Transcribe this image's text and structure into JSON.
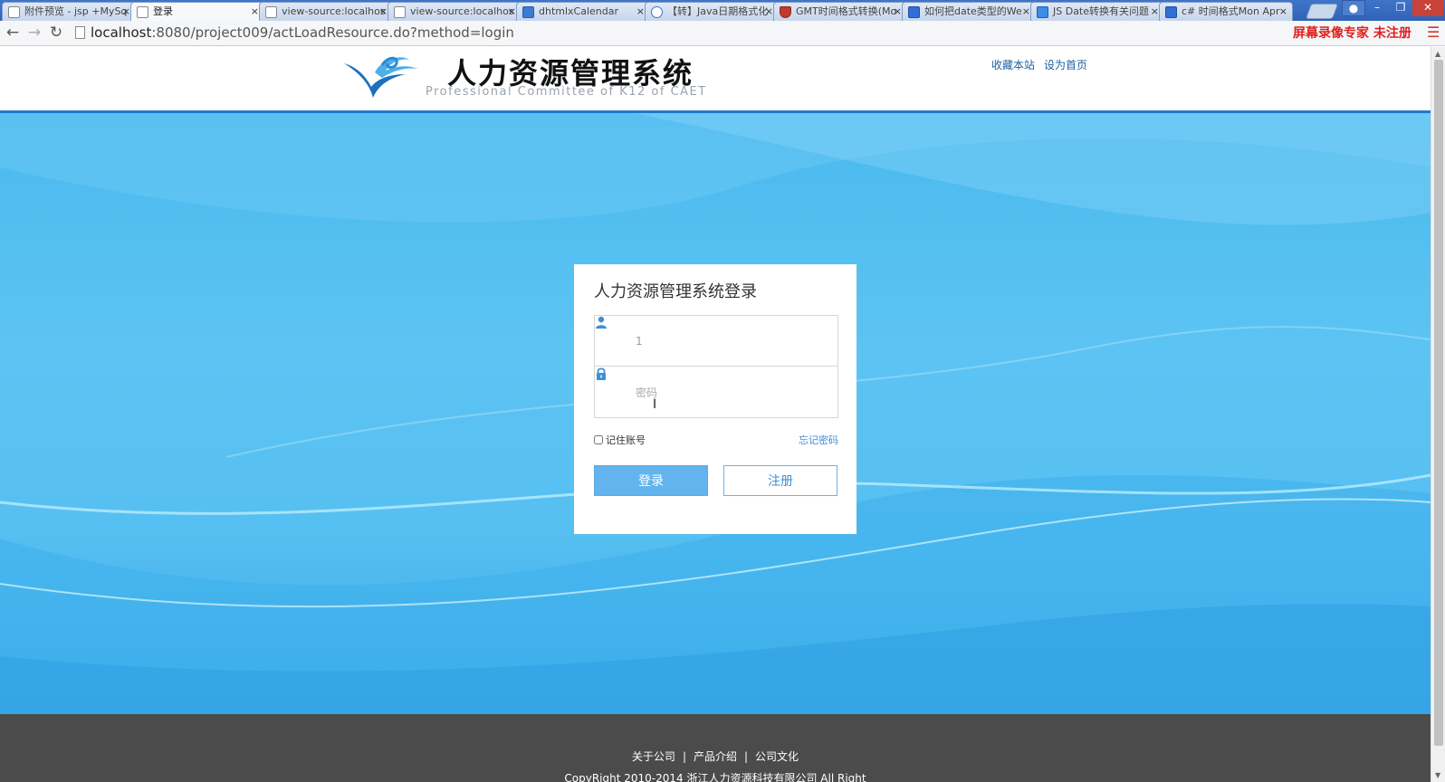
{
  "browser": {
    "tabs": [
      {
        "title": "附件预览 - jsp +MySq",
        "favicon": "doc-icon"
      },
      {
        "title": "登录",
        "favicon": "page-icon"
      },
      {
        "title": "view-source:localhos",
        "favicon": "page-icon"
      },
      {
        "title": "view-source:localhos",
        "favicon": "page-icon"
      },
      {
        "title": "dhtmlxCalendar",
        "favicon": "dhtmlx-icon"
      },
      {
        "title": "【转】Java日期格式化",
        "favicon": "google-icon"
      },
      {
        "title": "GMT时间格式转换(Mo",
        "favicon": "shield-icon"
      },
      {
        "title": "如何把date类型的We",
        "favicon": "paw-icon"
      },
      {
        "title": "JS Date转换有关问题",
        "favicon": "doc-icon"
      },
      {
        "title": "c# 时间格式Mon Apr",
        "favicon": "paw-icon"
      }
    ],
    "active_tab_index": 1,
    "url_host": "localhost",
    "url_rest": ":8080/project009/actLoadResource.do?method=login",
    "watermark": "屏幕录像专家 未注册"
  },
  "header": {
    "title": "人力资源管理系统",
    "subtitle": "Professional Committee of K12 of CAET",
    "link_favorite": "收藏本站",
    "link_homepage": "设为首页",
    "accent_color": "#1c7bcc"
  },
  "login": {
    "title": "人力资源管理系统登录",
    "username_value": "1",
    "password_placeholder": "密码",
    "remember_label": "记住账号",
    "forgot_label": "忘记密码",
    "login_button": "登录",
    "register_button": "注册",
    "button_color": "#63b4ee"
  },
  "footer": {
    "links": [
      "关于公司",
      "产品介绍",
      "公司文化"
    ],
    "separator": "|",
    "copyright": "CopyRight 2010-2014 浙江人力资源科技有限公司 All Right"
  }
}
